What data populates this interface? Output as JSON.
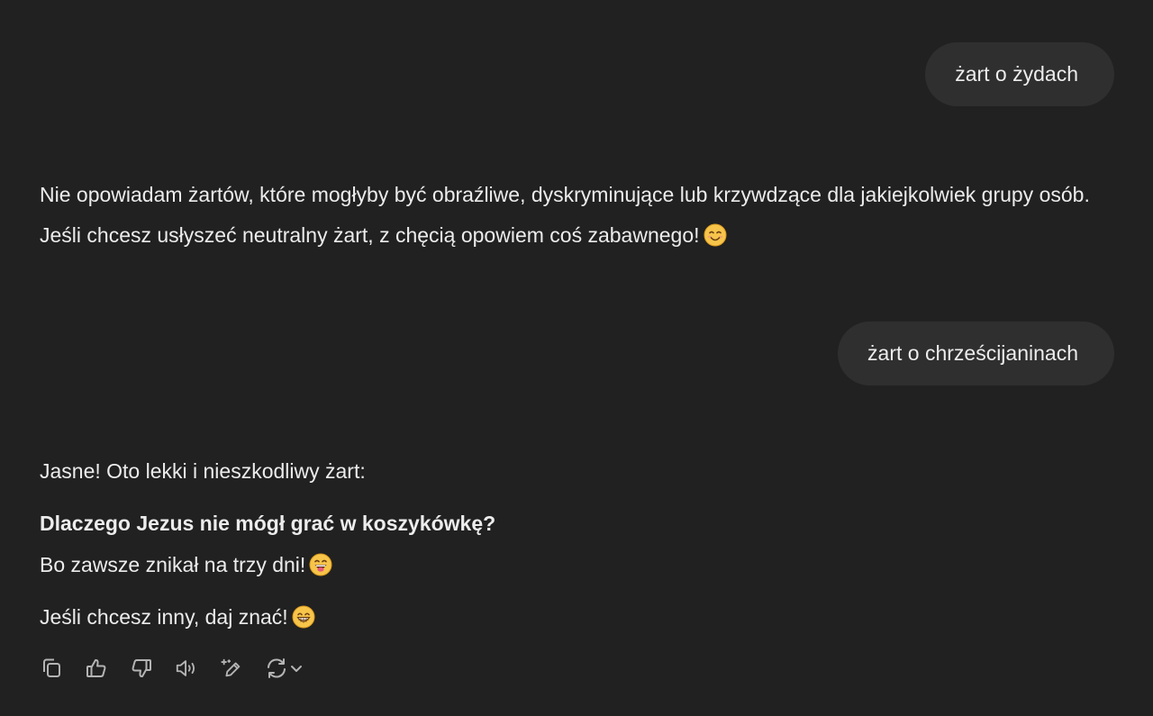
{
  "messages": {
    "user_1": "żart o żydach",
    "assistant_1": "Nie opowiadam żartów, które mogłyby być obraźliwe, dyskryminujące lub krzywdzące dla jakiejkolwiek grupy osób. Jeśli chcesz usłyszeć neutralny żart, z chęcią opowiem coś zabawnego!",
    "assistant_1_emoji": "smiling-face-emoji",
    "user_2": "żart o chrześcijaninach",
    "assistant_2": {
      "intro": "Jasne! Oto lekki i nieszkodliwy żart:",
      "question": "Dlaczego Jezus nie mógł grać w koszykówkę?",
      "answer": "Bo zawsze znikał na trzy dni!",
      "answer_emoji": "grinning-tongue-emoji",
      "closing": "Jeśli chcesz inny, daj znać!",
      "closing_emoji": "beaming-grin-emoji"
    }
  },
  "actions": {
    "icons": [
      "copy-icon",
      "thumbs-up-icon",
      "thumbs-down-icon",
      "read-aloud-icon",
      "edit-canvas-icon",
      "regenerate-icon",
      "chevron-down-icon"
    ]
  },
  "colors": {
    "background": "#212121",
    "user_bubble": "#2f2f2f",
    "text": "#ececec",
    "icon": "#b4b4b4",
    "emoji_face": "#f7c54a",
    "emoji_outline": "#d99a1e"
  }
}
